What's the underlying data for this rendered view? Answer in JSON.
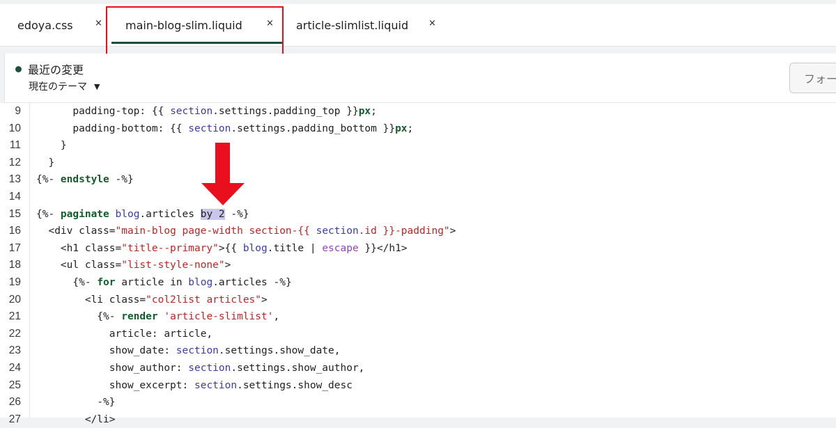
{
  "tabs": [
    {
      "label": "edoya.css",
      "close": "×"
    },
    {
      "label": "main-blog-slim.liquid",
      "close": "×"
    },
    {
      "label": "article-slimlist.liquid",
      "close": "×"
    }
  ],
  "header": {
    "title": "最近の変更",
    "theme_label": "現在のテーマ",
    "format_button": "フォー"
  },
  "colors": {
    "accent": "#1d4d3c",
    "highlight": "#ea0f1c",
    "keyword": "#145c2c",
    "string": "#b42828"
  },
  "code_lines": [
    {
      "n": "9",
      "t": "      padding-top: {{ section.settings.padding_top }}px;"
    },
    {
      "n": "10",
      "t": "      padding-bottom: {{ section.settings.padding_bottom }}px;"
    },
    {
      "n": "11",
      "t": "    }"
    },
    {
      "n": "12",
      "t": "  }"
    },
    {
      "n": "13",
      "t": "{%- endstyle -%}"
    },
    {
      "n": "14",
      "t": ""
    },
    {
      "n": "15",
      "t": "{%- paginate blog.articles by 2 -%}"
    },
    {
      "n": "16",
      "t": "  <div class=\"main-blog page-width section-{{ section.id }}-padding\">"
    },
    {
      "n": "17",
      "t": "    <h1 class=\"title--primary\">{{ blog.title | escape }}</h1>"
    },
    {
      "n": "18",
      "t": "    <ul class=\"list-style-none\">"
    },
    {
      "n": "19",
      "t": "      {%- for article in blog.articles -%}"
    },
    {
      "n": "20",
      "t": "        <li class=\"col2list articles\">"
    },
    {
      "n": "21",
      "t": "          {%- render 'article-slimlist',"
    },
    {
      "n": "22",
      "t": "            article: article,"
    },
    {
      "n": "23",
      "t": "            show_date: section.settings.show_date,"
    },
    {
      "n": "24",
      "t": "            show_author: section.settings.show_author,"
    },
    {
      "n": "25",
      "t": "            show_excerpt: section.settings.show_desc"
    },
    {
      "n": "26",
      "t": "          -%}"
    },
    {
      "n": "27",
      "t": "        </li>"
    }
  ]
}
